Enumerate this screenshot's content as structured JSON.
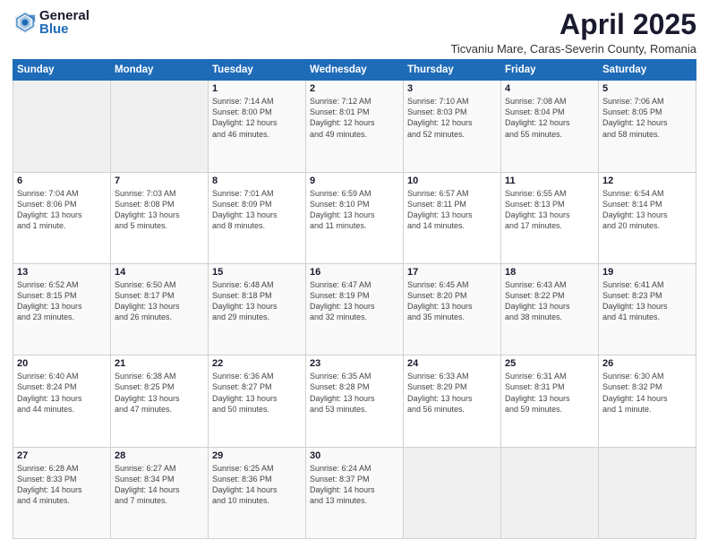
{
  "logo": {
    "general": "General",
    "blue": "Blue"
  },
  "title": "April 2025",
  "location": "Ticvaniu Mare, Caras-Severin County, Romania",
  "weekdays": [
    "Sunday",
    "Monday",
    "Tuesday",
    "Wednesday",
    "Thursday",
    "Friday",
    "Saturday"
  ],
  "weeks": [
    [
      {
        "day": "",
        "info": ""
      },
      {
        "day": "",
        "info": ""
      },
      {
        "day": "1",
        "info": "Sunrise: 7:14 AM\nSunset: 8:00 PM\nDaylight: 12 hours\nand 46 minutes."
      },
      {
        "day": "2",
        "info": "Sunrise: 7:12 AM\nSunset: 8:01 PM\nDaylight: 12 hours\nand 49 minutes."
      },
      {
        "day": "3",
        "info": "Sunrise: 7:10 AM\nSunset: 8:03 PM\nDaylight: 12 hours\nand 52 minutes."
      },
      {
        "day": "4",
        "info": "Sunrise: 7:08 AM\nSunset: 8:04 PM\nDaylight: 12 hours\nand 55 minutes."
      },
      {
        "day": "5",
        "info": "Sunrise: 7:06 AM\nSunset: 8:05 PM\nDaylight: 12 hours\nand 58 minutes."
      }
    ],
    [
      {
        "day": "6",
        "info": "Sunrise: 7:04 AM\nSunset: 8:06 PM\nDaylight: 13 hours\nand 1 minute."
      },
      {
        "day": "7",
        "info": "Sunrise: 7:03 AM\nSunset: 8:08 PM\nDaylight: 13 hours\nand 5 minutes."
      },
      {
        "day": "8",
        "info": "Sunrise: 7:01 AM\nSunset: 8:09 PM\nDaylight: 13 hours\nand 8 minutes."
      },
      {
        "day": "9",
        "info": "Sunrise: 6:59 AM\nSunset: 8:10 PM\nDaylight: 13 hours\nand 11 minutes."
      },
      {
        "day": "10",
        "info": "Sunrise: 6:57 AM\nSunset: 8:11 PM\nDaylight: 13 hours\nand 14 minutes."
      },
      {
        "day": "11",
        "info": "Sunrise: 6:55 AM\nSunset: 8:13 PM\nDaylight: 13 hours\nand 17 minutes."
      },
      {
        "day": "12",
        "info": "Sunrise: 6:54 AM\nSunset: 8:14 PM\nDaylight: 13 hours\nand 20 minutes."
      }
    ],
    [
      {
        "day": "13",
        "info": "Sunrise: 6:52 AM\nSunset: 8:15 PM\nDaylight: 13 hours\nand 23 minutes."
      },
      {
        "day": "14",
        "info": "Sunrise: 6:50 AM\nSunset: 8:17 PM\nDaylight: 13 hours\nand 26 minutes."
      },
      {
        "day": "15",
        "info": "Sunrise: 6:48 AM\nSunset: 8:18 PM\nDaylight: 13 hours\nand 29 minutes."
      },
      {
        "day": "16",
        "info": "Sunrise: 6:47 AM\nSunset: 8:19 PM\nDaylight: 13 hours\nand 32 minutes."
      },
      {
        "day": "17",
        "info": "Sunrise: 6:45 AM\nSunset: 8:20 PM\nDaylight: 13 hours\nand 35 minutes."
      },
      {
        "day": "18",
        "info": "Sunrise: 6:43 AM\nSunset: 8:22 PM\nDaylight: 13 hours\nand 38 minutes."
      },
      {
        "day": "19",
        "info": "Sunrise: 6:41 AM\nSunset: 8:23 PM\nDaylight: 13 hours\nand 41 minutes."
      }
    ],
    [
      {
        "day": "20",
        "info": "Sunrise: 6:40 AM\nSunset: 8:24 PM\nDaylight: 13 hours\nand 44 minutes."
      },
      {
        "day": "21",
        "info": "Sunrise: 6:38 AM\nSunset: 8:25 PM\nDaylight: 13 hours\nand 47 minutes."
      },
      {
        "day": "22",
        "info": "Sunrise: 6:36 AM\nSunset: 8:27 PM\nDaylight: 13 hours\nand 50 minutes."
      },
      {
        "day": "23",
        "info": "Sunrise: 6:35 AM\nSunset: 8:28 PM\nDaylight: 13 hours\nand 53 minutes."
      },
      {
        "day": "24",
        "info": "Sunrise: 6:33 AM\nSunset: 8:29 PM\nDaylight: 13 hours\nand 56 minutes."
      },
      {
        "day": "25",
        "info": "Sunrise: 6:31 AM\nSunset: 8:31 PM\nDaylight: 13 hours\nand 59 minutes."
      },
      {
        "day": "26",
        "info": "Sunrise: 6:30 AM\nSunset: 8:32 PM\nDaylight: 14 hours\nand 1 minute."
      }
    ],
    [
      {
        "day": "27",
        "info": "Sunrise: 6:28 AM\nSunset: 8:33 PM\nDaylight: 14 hours\nand 4 minutes."
      },
      {
        "day": "28",
        "info": "Sunrise: 6:27 AM\nSunset: 8:34 PM\nDaylight: 14 hours\nand 7 minutes."
      },
      {
        "day": "29",
        "info": "Sunrise: 6:25 AM\nSunset: 8:36 PM\nDaylight: 14 hours\nand 10 minutes."
      },
      {
        "day": "30",
        "info": "Sunrise: 6:24 AM\nSunset: 8:37 PM\nDaylight: 14 hours\nand 13 minutes."
      },
      {
        "day": "",
        "info": ""
      },
      {
        "day": "",
        "info": ""
      },
      {
        "day": "",
        "info": ""
      }
    ]
  ]
}
